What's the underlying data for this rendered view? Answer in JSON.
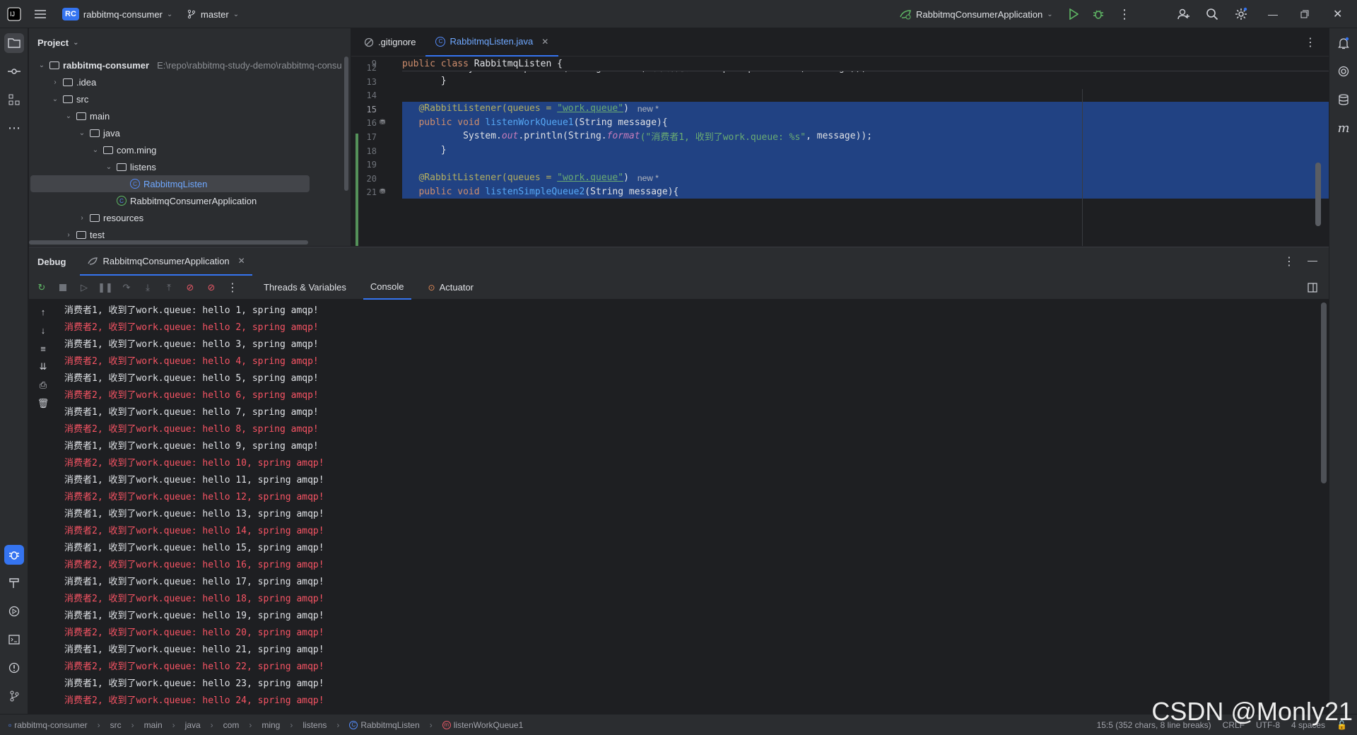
{
  "titlebar": {
    "project_badge": "RC",
    "project_name": "rabbitmq-consumer",
    "branch": "master",
    "run_config": "RabbitmqConsumerApplication"
  },
  "project_panel": {
    "title": "Project",
    "tree": [
      {
        "label": "rabbitmq-consumer",
        "path": "E:\\repo\\rabbitmq-study-demo\\rabbitmq-consu",
        "indent": 0,
        "arrow": "open",
        "icon": "module"
      },
      {
        "label": ".idea",
        "indent": 1,
        "arrow": "closed",
        "icon": "folder"
      },
      {
        "label": "src",
        "indent": 1,
        "arrow": "open",
        "icon": "folder"
      },
      {
        "label": "main",
        "indent": 2,
        "arrow": "open",
        "icon": "folder"
      },
      {
        "label": "java",
        "indent": 3,
        "arrow": "open",
        "icon": "folder"
      },
      {
        "label": "com.ming",
        "indent": 4,
        "arrow": "open",
        "icon": "folder"
      },
      {
        "label": "listens",
        "indent": 5,
        "arrow": "open",
        "icon": "folder"
      },
      {
        "label": "RabbitmqListen",
        "indent": 6,
        "arrow": "none",
        "icon": "class",
        "selected": true
      },
      {
        "label": "RabbitmqConsumerApplication",
        "indent": 5,
        "arrow": "none",
        "icon": "spring-class"
      },
      {
        "label": "resources",
        "indent": 3,
        "arrow": "closed",
        "icon": "folder"
      },
      {
        "label": "test",
        "indent": 2,
        "arrow": "closed",
        "icon": "folder"
      }
    ]
  },
  "editor": {
    "tabs": [
      {
        "label": ".gitignore",
        "active": false
      },
      {
        "label": "RabbitmqListen.java",
        "active": true
      }
    ],
    "sticky_line": {
      "num": "9",
      "code": "public class RabbitmqListen {"
    },
    "lines": [
      {
        "num": "12",
        "code": "        System.out.println(String.format(\"消费者收到了simple.queue: %s\", message));"
      },
      {
        "num": "13",
        "code": "    }"
      },
      {
        "num": "14",
        "code": ""
      },
      {
        "num": "15",
        "annotation": "@RabbitListener(queues = ",
        "q": "\"work.queue\"",
        "tail": ")",
        "hint": "new *",
        "selected": true
      },
      {
        "num": "16",
        "kw": "public void ",
        "fn": "listenWorkQueue1",
        "rest": "(String message){",
        "selected": true
      },
      {
        "num": "17",
        "pre": "        System.",
        "out": "out",
        "mid": ".println(String.",
        "fmt": "format",
        "str": "(\"消费者1, 收到了work.queue: %s\"",
        "post": ", message));",
        "selected": true
      },
      {
        "num": "18",
        "code": "    }",
        "selected": true
      },
      {
        "num": "19",
        "code": "",
        "selected": true
      },
      {
        "num": "20",
        "annotation": "@RabbitListener(queues = ",
        "q": "\"work.queue\"",
        "tail": ")",
        "hint": "new *",
        "selected": true
      },
      {
        "num": "21",
        "kw": "public void ",
        "fn": "listenSimpleQueue2",
        "rest": "(String message){",
        "selected": true
      }
    ]
  },
  "debug": {
    "title": "Debug",
    "session": "RabbitmqConsumerApplication",
    "tabs": [
      "Threads & Variables",
      "Console",
      "Actuator"
    ],
    "active_tab": "Console",
    "log": [
      {
        "text": "消费者1, 收到了work.queue: hello 1, spring amqp!",
        "err": false
      },
      {
        "text": "消费者2, 收到了work.queue: hello 2, spring amqp!",
        "err": true
      },
      {
        "text": "消费者1, 收到了work.queue: hello 3, spring amqp!",
        "err": false
      },
      {
        "text": "消费者2, 收到了work.queue: hello 4, spring amqp!",
        "err": true
      },
      {
        "text": "消费者1, 收到了work.queue: hello 5, spring amqp!",
        "err": false
      },
      {
        "text": "消费者2, 收到了work.queue: hello 6, spring amqp!",
        "err": true
      },
      {
        "text": "消费者1, 收到了work.queue: hello 7, spring amqp!",
        "err": false
      },
      {
        "text": "消费者2, 收到了work.queue: hello 8, spring amqp!",
        "err": true
      },
      {
        "text": "消费者1, 收到了work.queue: hello 9, spring amqp!",
        "err": false
      },
      {
        "text": "消费者2, 收到了work.queue: hello 10, spring amqp!",
        "err": true
      },
      {
        "text": "消费者1, 收到了work.queue: hello 11, spring amqp!",
        "err": false
      },
      {
        "text": "消费者2, 收到了work.queue: hello 12, spring amqp!",
        "err": true
      },
      {
        "text": "消费者1, 收到了work.queue: hello 13, spring amqp!",
        "err": false
      },
      {
        "text": "消费者2, 收到了work.queue: hello 14, spring amqp!",
        "err": true
      },
      {
        "text": "消费者1, 收到了work.queue: hello 15, spring amqp!",
        "err": false
      },
      {
        "text": "消费者2, 收到了work.queue: hello 16, spring amqp!",
        "err": true
      },
      {
        "text": "消费者1, 收到了work.queue: hello 17, spring amqp!",
        "err": false
      },
      {
        "text": "消费者2, 收到了work.queue: hello 18, spring amqp!",
        "err": true
      },
      {
        "text": "消费者1, 收到了work.queue: hello 19, spring amqp!",
        "err": false
      },
      {
        "text": "消费者2, 收到了work.queue: hello 20, spring amqp!",
        "err": true
      },
      {
        "text": "消费者1, 收到了work.queue: hello 21, spring amqp!",
        "err": false
      },
      {
        "text": "消费者2, 收到了work.queue: hello 22, spring amqp!",
        "err": true
      },
      {
        "text": "消费者1, 收到了work.queue: hello 23, spring amqp!",
        "err": false
      },
      {
        "text": "消费者2, 收到了work.queue: hello 24, spring amqp!",
        "err": true
      }
    ]
  },
  "statusbar": {
    "breadcrumbs": [
      "rabbitmq-consumer",
      "src",
      "main",
      "java",
      "com",
      "ming",
      "listens",
      "RabbitmqListen",
      "listenWorkQueue1"
    ],
    "position": "15:5 (352 chars, 8 line breaks)",
    "line_sep": "CRLF",
    "encoding": "UTF-8",
    "indent": "4 spaces"
  },
  "watermark": "CSDN @Monly21",
  "colors": {
    "accent": "#3574f0",
    "selection": "#214283",
    "error": "#f75464"
  }
}
